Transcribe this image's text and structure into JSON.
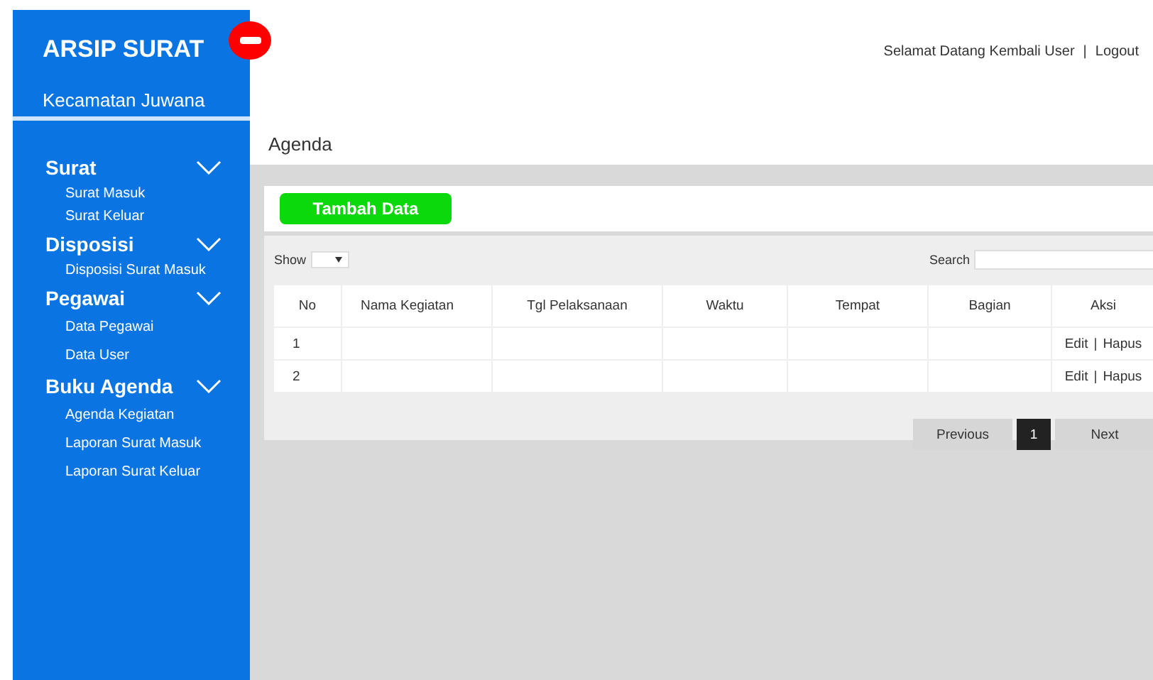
{
  "brand": {
    "title": "ARSIP SURAT",
    "subtitle": "Kecamatan Juwana"
  },
  "header": {
    "greeting": "Selamat Datang Kembali User",
    "separator": "|",
    "logout": "Logout"
  },
  "sidebar": {
    "groups": [
      {
        "label": "Surat",
        "items": [
          "Surat Masuk",
          "Surat Keluar"
        ]
      },
      {
        "label": "Disposisi",
        "items": [
          "Disposisi Surat Masuk"
        ]
      },
      {
        "label": "Pegawai",
        "items": [
          "Data Pegawai",
          "Data User"
        ]
      },
      {
        "label": "Buku Agenda",
        "items": [
          "Agenda Kegiatan",
          "Laporan Surat Masuk",
          "Laporan Surat Keluar"
        ]
      }
    ]
  },
  "page_title": "Agenda",
  "add_button": "Tambah Data",
  "show_label": "Show",
  "search_label": "Search",
  "table": {
    "columns": [
      "No",
      "Nama Kegiatan",
      "Tgl Pelaksanaan",
      "Waktu",
      "Tempat",
      "Bagian",
      "Aksi"
    ],
    "rows": [
      {
        "no": "1",
        "actions": {
          "edit": "Edit",
          "separator": "|",
          "delete": "Hapus"
        }
      },
      {
        "no": "2",
        "actions": {
          "edit": "Edit",
          "separator": "|",
          "delete": "Hapus"
        }
      }
    ]
  },
  "pagination": {
    "previous": "Previous",
    "pages": [
      {
        "label": "1",
        "selected": true
      }
    ],
    "next": "Next"
  }
}
